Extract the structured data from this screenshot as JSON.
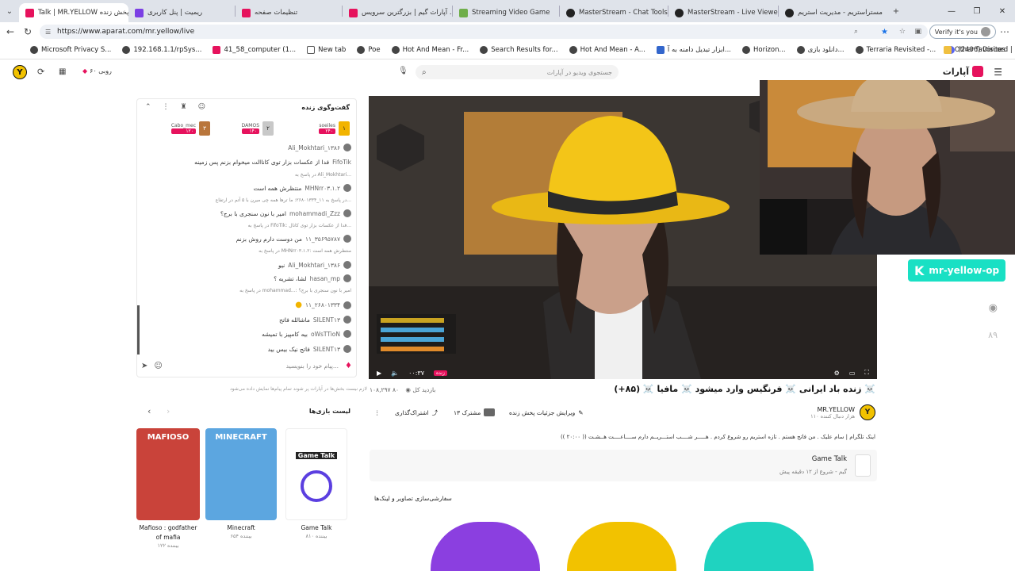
{
  "browser": {
    "tabs": [
      {
        "label": "Talk | MR.YELLOW پخش زنده",
        "active": true
      },
      {
        "label": "ریمیت | پنل کاربری"
      },
      {
        "label": "تنظیمات صفحه"
      },
      {
        "label": "آپارات گیم | بزرگترین سرویس ...."
      },
      {
        "label": "Streaming Video Game"
      },
      {
        "label": "MasterStream - Chat Tools"
      },
      {
        "label": "MasterStream - Live Viewer"
      },
      {
        "label": "مستراستریم - مدیریت استریم"
      }
    ],
    "url": "https://www.aparat.com/mr.yellow/live",
    "verify_label": "Verify it's you",
    "bookmarks": [
      "Microsoft Privacy S...",
      "192.168.1.1/rpSys...",
      "41_58_computer (1...",
      "New tab",
      "Poe",
      "Hot And Mean - Fr...",
      "Search Results for...",
      "Hot And Mean - A...",
      "ابزار تبدیل دامنه به آ...",
      "Horizon...",
      "دانلود بازی...",
      "Terraria Revisited -...",
      "(2406) Discord | ..."
    ],
    "other_favorites": "Other favorites"
  },
  "site": {
    "logo": "آپارات",
    "search_placeholder": "جستجوی ویدیو در آپارات",
    "coins": "۶۰ روبی"
  },
  "chat": {
    "header": "گفت‌وگوی زنده",
    "top_users": [
      {
        "rank": "۱",
        "name": "soeiles",
        "amount": "۲۴۰"
      },
      {
        "rank": "۲",
        "name": "DAMOS",
        "amount": "۱۴۰"
      },
      {
        "rank": "۳",
        "name": "Cabo_mec",
        "amount": "۱۲۰"
      }
    ],
    "messages": [
      {
        "user": "Ali_Mokhtari_۱۳۸۶",
        "text": ""
      },
      {
        "user": "FifoTik",
        "text": "فدا از عکسات بزار توی کاناالت میخوام بزنم پس زمینه"
      },
      {
        "user": "",
        "text": "در پاسخ به Ali_Mokhtari..."
      },
      {
        "user": "MHNrr۰۳.۱.۲",
        "text": "منتظرش همه است"
      },
      {
        "user": "",
        "text": "در پاسخ به ۱۱_۲۶۸۰۱۳۳۴: ما ترها همه چی میرن با ۵ آتم در ارتفاع..."
      },
      {
        "user": "mohammadi_Zzz",
        "text": "امیر با نون سنجری با برج؟"
      },
      {
        "user": "",
        "text": "در پاسخ به FifoTik: فدا از عکسات بزار توی کانال..."
      },
      {
        "user": "۱۱_۳۵۶۹۵۷۸۷",
        "text": "من دوست دارم روش بزنم"
      },
      {
        "user": "",
        "text": "در پاسخ به MHNrr۰۳.۱.۲: منتظرش همه است"
      },
      {
        "user": "Ali_Mokhtari_۱۳۸۶",
        "text": "نیو"
      },
      {
        "user": "hasan_mp",
        "text": "لشا، تشریه ؟"
      },
      {
        "user": "",
        "text": "در پاسخ به mohammad...: امیر با نون سنجری با برج؟"
      },
      {
        "user": "۱۱_۲۶۸۰۱۳۳۴",
        "text": ""
      },
      {
        "user": "SILENT۱۳",
        "text": "ماشالله فاتح"
      },
      {
        "user": "oWsTTioN",
        "text": "بیه کامپیز با تمیشه"
      },
      {
        "user": "SILENT۱۳",
        "text": "فاتح نیک بیس بید"
      }
    ],
    "input_placeholder": "پیام خود را بنویسید..."
  },
  "video": {
    "time": "۰۰:۳۷",
    "live_label": "زنده",
    "overlay_badge": "mr-yellow-op",
    "title": "☠️ زنده باد ایرانی ☠️ فرنگیس وارد میشود ☠️ مافیا ☠️ (۸۵+)",
    "viewers": "۸۰",
    "total_views": "۱۰۸,۲۹۷ بازدید کل",
    "channel_name": "MR.YELLOW",
    "channel_sub": "۱۱۰ هزار دنبال کننده",
    "subscribe_label": "۱۳ مشترک",
    "share_label": "اشتراک‌گذاری",
    "edit_label": "ویرایش جزئیات پخش زنده",
    "description": "اینک تلگرام | سام علیک . من فاتح هستم . تازه استریم رو شروع کردم . هـــــر شــــب استـــریــم دارم ســــاعــــت هــشـت (( ۲۰:۰۰ ))",
    "game_title": "Game Talk",
    "game_sub": "گیم - شروع از ۱۲ دقیقه پیش",
    "customize_label": "سفارشی‌سازی تصاویر و لینک‌ها",
    "disclaimer": "لازم نیست بخش‌ها در آپارات پر شوند تمام پیام‌ها نمایش داده می‌شود"
  },
  "games": {
    "header": "لیست بازی‌ها",
    "items": [
      {
        "name": "Game Talk",
        "views": "۸۱۰ بیننده",
        "thumb_label": "Game Talk",
        "color": "#ffffff"
      },
      {
        "name": "Minecraft",
        "views": "۶۵۴ بیننده",
        "thumb_label": "MINECRAFT",
        "color": "#5ca6e0"
      },
      {
        "name": "Mafioso : godfather of mafia",
        "views": "۱۲۲ بیننده",
        "thumb_label": "MAFIOSO",
        "color": "#c9433a"
      }
    ]
  },
  "colors": {
    "accent": "#e6125d",
    "brand_yellow": "#f2c200",
    "badge": "#19e0c4"
  }
}
